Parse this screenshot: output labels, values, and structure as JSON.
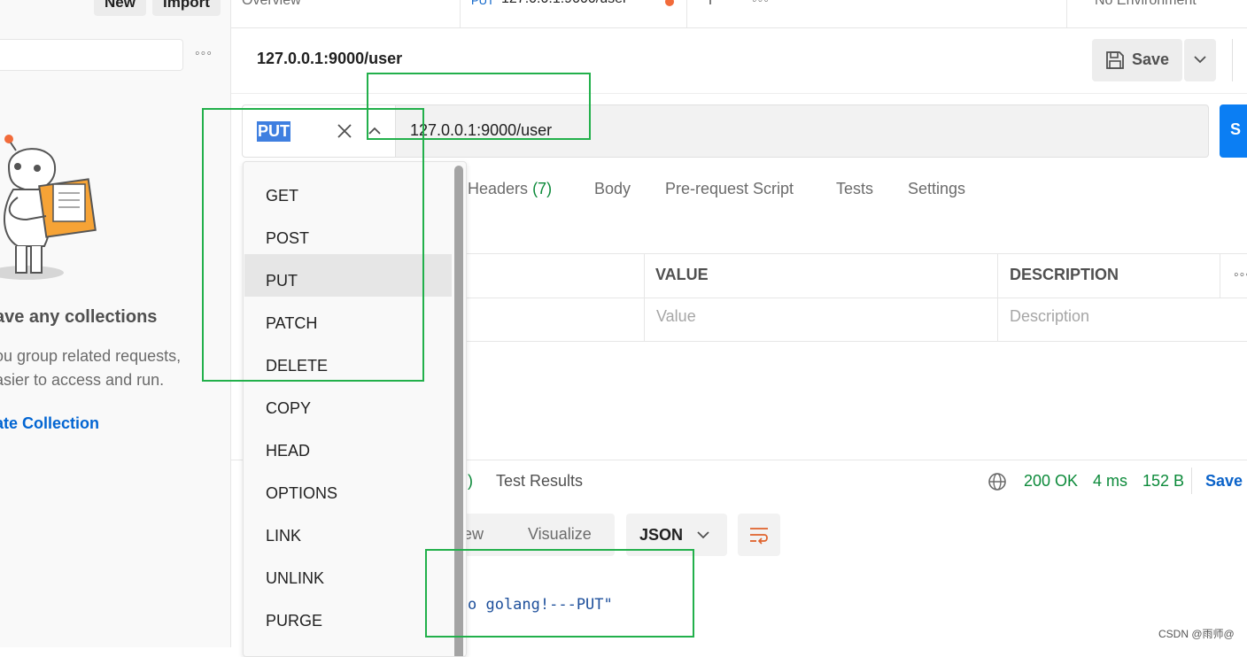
{
  "sidebar": {
    "new_label": "New",
    "import_label": "Import",
    "empty_title": "ave any collections",
    "empty_desc_line1": "ou group related requests,",
    "empty_desc_line2": "asier to access and run.",
    "create_link": "ate Collection"
  },
  "tabs": {
    "overview": "Overview",
    "active_method": "PUT",
    "active_url": "127.0.0.1:9000/user",
    "environment": "No Environment"
  },
  "request": {
    "title": "127.0.0.1:9000/user",
    "save_label": "Save",
    "method": "PUT",
    "url": "127.0.0.1:9000/user",
    "send_label": "S"
  },
  "request_tabs": {
    "headers": "Headers",
    "headers_count": "(7)",
    "body": "Body",
    "prerequest": "Pre-request Script",
    "tests": "Tests",
    "settings": "Settings"
  },
  "params_table": {
    "col_value": "VALUE",
    "col_description": "DESCRIPTION",
    "value_placeholder": "Value",
    "description_placeholder": "Description"
  },
  "response": {
    "paren": ")",
    "test_results": "Test Results",
    "status": "200 OK",
    "time": "4 ms",
    "size": "152 B",
    "save_label": "Save",
    "view_partial": "ew",
    "visualize": "Visualize",
    "format": "JSON",
    "body_text": "o golang!---PUT\""
  },
  "method_menu": {
    "items": [
      "GET",
      "POST",
      "PUT",
      "PATCH",
      "DELETE",
      "COPY",
      "HEAD",
      "OPTIONS",
      "LINK",
      "UNLINK",
      "PURGE"
    ],
    "selected": "PUT"
  },
  "colors": {
    "accent": "#0b7ef3",
    "success": "#0c8a3a",
    "annotation": "#22b04b",
    "tab_dot": "#f26b3a"
  },
  "watermark": "CSDN @雨师@"
}
